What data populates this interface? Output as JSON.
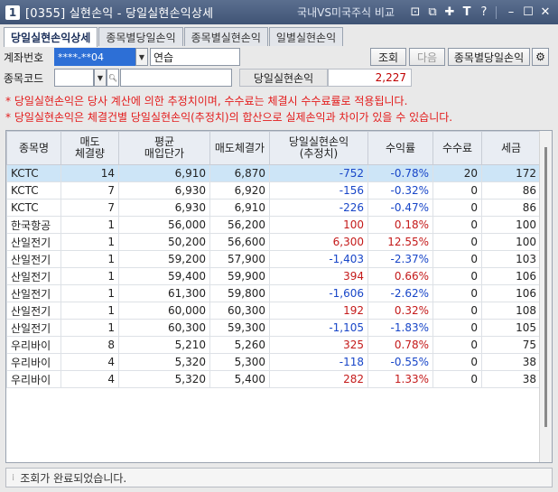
{
  "window": {
    "badge": "1",
    "title": "[0355] 실현손익 - 당일실현손익상세",
    "compare_link": "국내VS미국주식 비교"
  },
  "tabs": [
    {
      "label": "당일실현손익상세",
      "active": true
    },
    {
      "label": "종목별당일손익",
      "active": false
    },
    {
      "label": "종목별실현손익",
      "active": false
    },
    {
      "label": "일별실현손익",
      "active": false
    }
  ],
  "account": {
    "label": "계좌번호",
    "number": "****-**04",
    "name": "연습"
  },
  "stock": {
    "label": "종목코드",
    "code": "",
    "name": ""
  },
  "buttons": {
    "search": "조회",
    "next": "다음",
    "by_stock": "종목별당일손익"
  },
  "summary": {
    "label": "당일실현손익",
    "value": "2,227"
  },
  "notices": [
    "* 당일실현손익은 당사 계산에 의한 추정치이며, 수수료는 체결시 수수료률로 적용됩니다.",
    "* 당일실현손익은 체결건별 당일실현손익(추정치)의 합산으로 실제손익과 차이가 있을 수 있습니다."
  ],
  "table": {
    "headers": [
      [
        "종목명"
      ],
      [
        "매도",
        "체결량"
      ],
      [
        "평균",
        "매입단가"
      ],
      [
        "매도체결가"
      ],
      [
        "당일실현손익",
        "(추정치)"
      ],
      [
        "수익률"
      ],
      [
        "수수료"
      ],
      [
        "세금"
      ]
    ],
    "rows": [
      [
        "KCTC",
        "14",
        "6,910",
        "6,870",
        "-752",
        "-0.78%",
        "20",
        "172"
      ],
      [
        "KCTC",
        "7",
        "6,930",
        "6,920",
        "-156",
        "-0.32%",
        "0",
        "86"
      ],
      [
        "KCTC",
        "7",
        "6,930",
        "6,910",
        "-226",
        "-0.47%",
        "0",
        "86"
      ],
      [
        "한국항공",
        "1",
        "56,000",
        "56,200",
        "100",
        "0.18%",
        "0",
        "100"
      ],
      [
        "산일전기",
        "1",
        "50,200",
        "56,600",
        "6,300",
        "12.55%",
        "0",
        "100"
      ],
      [
        "산일전기",
        "1",
        "59,200",
        "57,900",
        "-1,403",
        "-2.37%",
        "0",
        "103"
      ],
      [
        "산일전기",
        "1",
        "59,400",
        "59,900",
        "394",
        "0.66%",
        "0",
        "106"
      ],
      [
        "산일전기",
        "1",
        "61,300",
        "59,800",
        "-1,606",
        "-2.62%",
        "0",
        "106"
      ],
      [
        "산일전기",
        "1",
        "60,000",
        "60,300",
        "192",
        "0.32%",
        "0",
        "108"
      ],
      [
        "산일전기",
        "1",
        "60,300",
        "59,300",
        "-1,105",
        "-1.83%",
        "0",
        "105"
      ],
      [
        "우리바이",
        "8",
        "5,210",
        "5,260",
        "325",
        "0.78%",
        "0",
        "75"
      ],
      [
        "우리바이",
        "4",
        "5,320",
        "5,300",
        "-118",
        "-0.55%",
        "0",
        "38"
      ],
      [
        "우리바이",
        "4",
        "5,320",
        "5,400",
        "282",
        "1.33%",
        "0",
        "38"
      ]
    ]
  },
  "status": "조회가 완료되었습니다.",
  "colors": {
    "positive": "#c41a1a",
    "negative": "#1846c8",
    "notice": "#e31b1b",
    "selected_row": "#cde5f7"
  }
}
